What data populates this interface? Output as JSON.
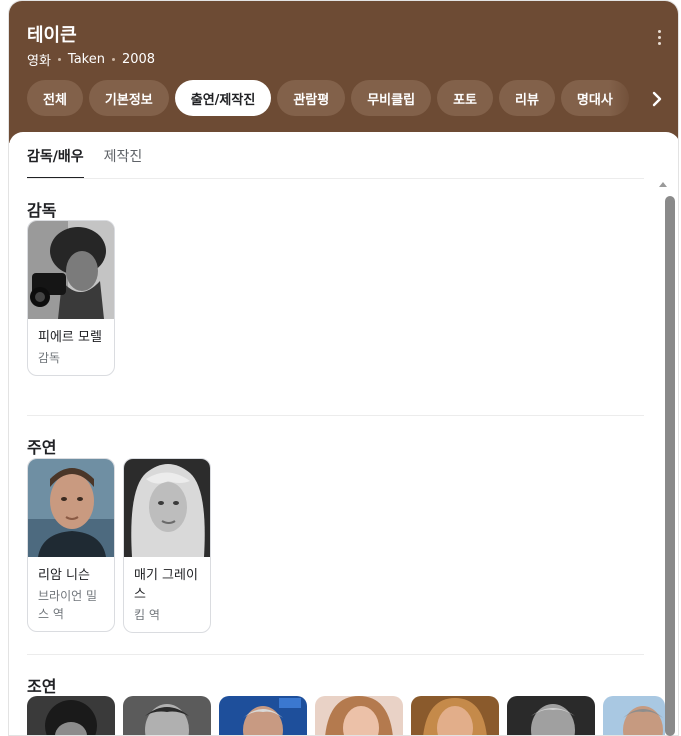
{
  "header": {
    "title": "테이큰",
    "category": "영화",
    "original_title": "Taken",
    "year": "2008",
    "more_icon": "more-vertical-icon",
    "bg_color": "#6d4b34"
  },
  "tabs": [
    {
      "label": "전체",
      "active": false
    },
    {
      "label": "기본정보",
      "active": false
    },
    {
      "label": "출연/제작진",
      "active": true
    },
    {
      "label": "관람평",
      "active": false
    },
    {
      "label": "무비클립",
      "active": false
    },
    {
      "label": "포토",
      "active": false
    },
    {
      "label": "리뷰",
      "active": false
    },
    {
      "label": "명대사",
      "active": false
    }
  ],
  "subtabs": [
    {
      "label": "감독/배우",
      "active": true
    },
    {
      "label": "제작진",
      "active": false
    }
  ],
  "sections": {
    "director": {
      "title": "감독",
      "people": [
        {
          "name": "피에르 모렐",
          "role": "감독"
        }
      ]
    },
    "lead": {
      "title": "주연",
      "people": [
        {
          "name": "리암 니슨",
          "role": "브라이언 밀스 역"
        },
        {
          "name": "매기 그레이스",
          "role": "킴 역"
        }
      ]
    },
    "supporting": {
      "title": "조연",
      "count_visible": 7
    }
  }
}
